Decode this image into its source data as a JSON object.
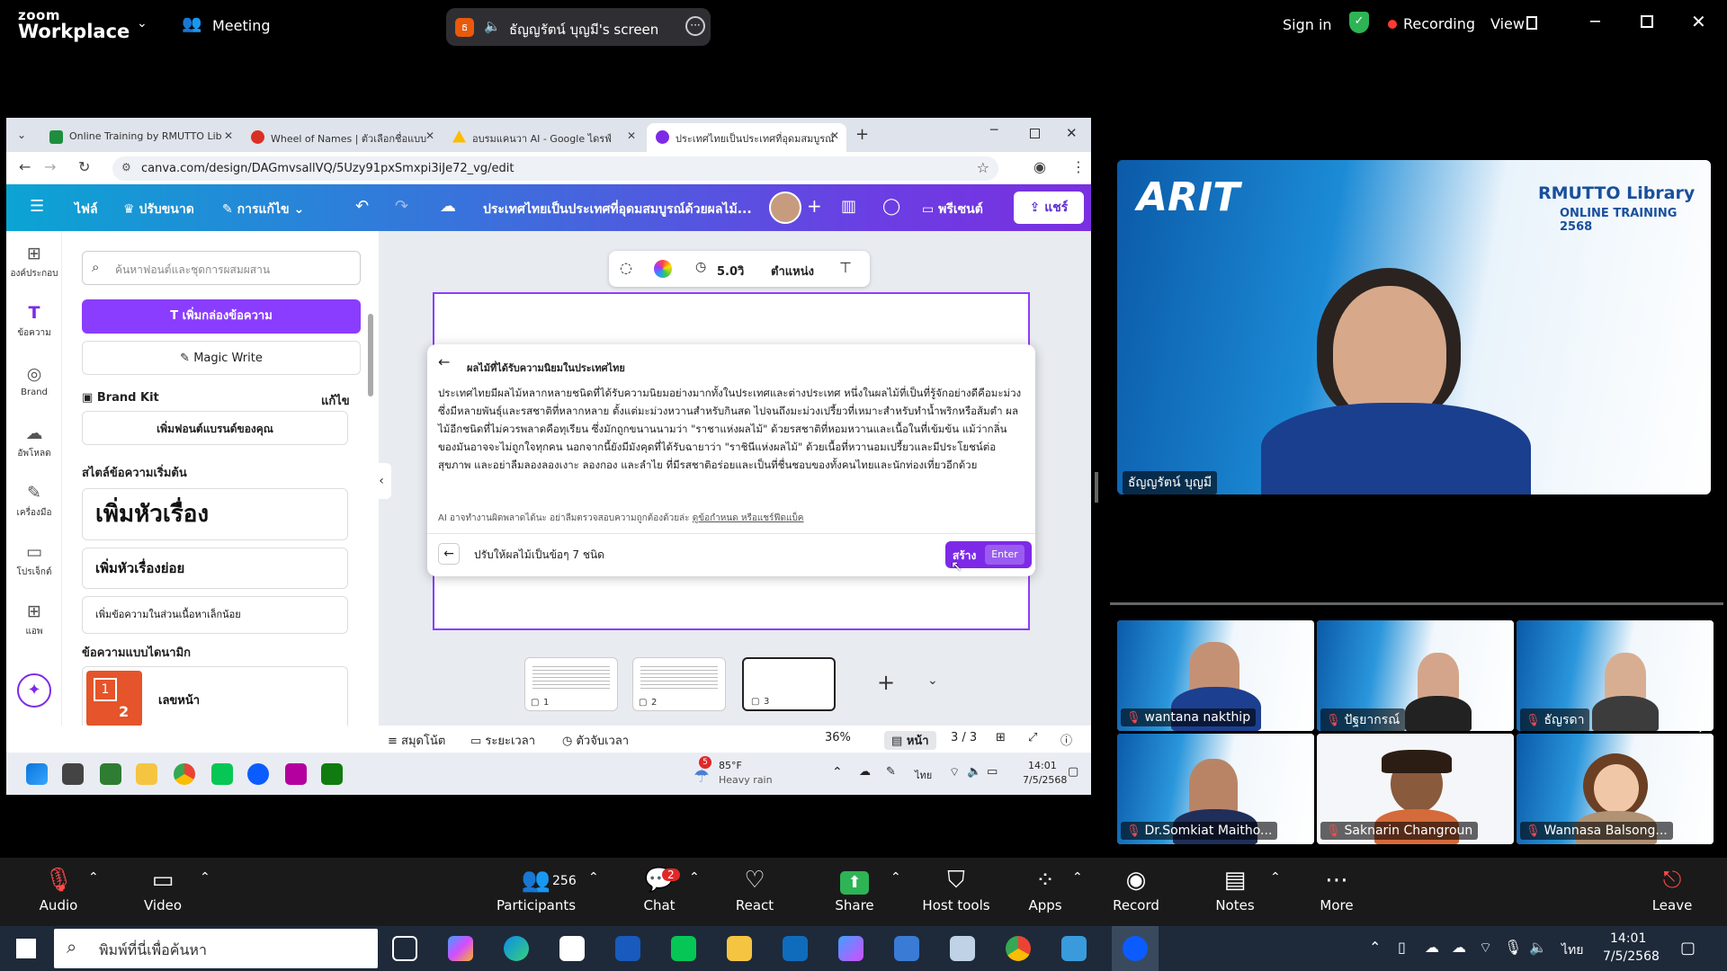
{
  "zoom": {
    "logo_line1": "zoom",
    "logo_line2": "Workplace",
    "meeting_label": "Meeting",
    "share_badge": "ธ",
    "share_label": "ธัญญรัตน์ บุญมี's screen",
    "sign_in": "Sign in",
    "recording": "Recording",
    "view": "View"
  },
  "browser": {
    "tabs": [
      {
        "label": "Online Training by RMUTTO Lib",
        "color": "#1e8e3e"
      },
      {
        "label": "Wheel of Names | ตัวเลือกชื่อแบบ",
        "color": "#d93025"
      },
      {
        "label": "อบรมแคนวา AI - Google ไดรฟ์",
        "color": "#fbbc04"
      },
      {
        "label": "ประเทศไทยเป็นประเทศที่อุดมสมบูรณ์",
        "color": "#7d2ae8"
      }
    ],
    "url": "canva.com/design/DAGmvsallVQ/5Uzy91pxSmxpi3iJe72_vg/edit"
  },
  "canva": {
    "menu": {
      "file": "ไฟล์",
      "resize": "ปรับขนาด",
      "edit": "การแก้ไข",
      "title": "ประเทศไทยเป็นประเทศที่อุดมสมบูรณ์ด้วยผลไม้...",
      "present": "พรีเซนต์",
      "share": "แชร์"
    },
    "rail": [
      {
        "icon": "⊞",
        "label": "องค์ประกอบ"
      },
      {
        "icon": "T",
        "label": "ข้อความ"
      },
      {
        "icon": "◎",
        "label": "Brand"
      },
      {
        "icon": "☁",
        "label": "อัพโหลด"
      },
      {
        "icon": "✎",
        "label": "เครื่องมือ"
      },
      {
        "icon": "▭",
        "label": "โปรเจ็กต์"
      },
      {
        "icon": "⊞",
        "label": "แอพ"
      }
    ],
    "panel": {
      "search_placeholder": "ค้นหาฟอนต์และชุดการผสมผสาน",
      "add_text_box": "เพิ่มกล่องข้อความ",
      "magic_write": "Magic Write",
      "brand_kit": "Brand Kit",
      "brand_edit": "แก้ไข",
      "add_brand_font": "เพิ่มฟอนต์แบรนด์ของคุณ",
      "default_styles": "สไตล์ข้อความเริ่มต้น",
      "heading": "เพิ่มหัวเรื่อง",
      "subheading": "เพิ่มหัวเรื่องย่อย",
      "body": "เพิ่มข้อความในส่วนเนื้อหาเล็กน้อย",
      "dynamic_text": "ข้อความแบบไดนามิก",
      "page_number": "เลขหน้า",
      "page_num_badge_1": "1",
      "page_num_badge_2": "2"
    },
    "toolbar": {
      "duration": "5.0วิ",
      "position": "ตำแหน่ง"
    },
    "ai": {
      "title": "ผลไม้ที่ได้รับความนิยมในประเทศไทย",
      "body": "ประเทศไทยมีผลไม้หลากหลายชนิดที่ได้รับความนิยมอย่างมากทั้งในประเทศและต่างประเทศ หนึ่งในผลไม้ที่เป็นที่รู้จักอย่างดีคือมะม่วง ซึ่งมีหลายพันธุ์และรสชาติที่หลากหลาย ตั้งแต่มะม่วงหวานสำหรับกินสด ไปจนถึงมะม่วงเปรี้ยวที่เหมาะสำหรับทำน้ำพริกหรือส้มตำ ผลไม้อีกชนิดที่ไม่ควรพลาดคือทุเรียน ซึ่งมักถูกขนานนามว่า \"ราชาแห่งผลไม้\" ด้วยรสชาติที่หอมหวานและเนื้อในที่เข้มข้น แม้ว่ากลิ่นของมันอาจจะไม่ถูกใจทุกคน นอกจากนี้ยังมีมังคุดที่ได้รับฉายาว่า \"ราชินีแห่งผลไม้\" ด้วยเนื้อที่หวานอมเปรี้ยวและมีประโยชน์ต่อสุขภาพ และอย่าลืมลองลองเงาะ ลองกอง และลำไย ที่มีรสชาติอร่อยและเป็นที่ชื่นชอบของทั้งคนไทยและนักท่องเที่ยวอีกด้วย",
      "disclaimer": "AI อาจทำงานผิดพลาดได้นะ อย่าลืมตรวจสอบความถูกต้องด้วยล่ะ",
      "disclaimer_link": "ดูข้อกำหนด หรือแชร์ฟีดแบ็ค",
      "prompt": "ปรับให้ผลไม้เป็นข้อๆ 7 ชนิด",
      "generate": "สร้าง",
      "enter": "Enter"
    },
    "thumbs": [
      {
        "num": "1"
      },
      {
        "num": "2"
      },
      {
        "num": "3"
      }
    ],
    "footer": {
      "notes": "สมุดโน้ต",
      "timeline": "ระยะเวลา",
      "timer": "ตัวจับเวลา",
      "zoom": "36%",
      "page_view": "หน้า",
      "pages": "3 / 3"
    }
  },
  "inner_taskbar": {
    "weather_badge": "5",
    "weather_temp": "85°F",
    "weather_desc": "Heavy rain",
    "lang": "ไทย",
    "time": "14:01",
    "date": "7/5/2568"
  },
  "videos": {
    "speaker": {
      "name": "ธัญญรัตน์ บุญมี",
      "logo": "ARIT",
      "banner1": "RMUTTO Library",
      "banner2": "ONLINE TRAINING 2568"
    },
    "gallery": [
      {
        "name": "wantana nakthip"
      },
      {
        "name": "ปัฐยากรณ์"
      },
      {
        "name": "ธัญรดา"
      },
      {
        "name": "Dr.Somkiat Maitho..."
      },
      {
        "name": "Saknarin Changroun"
      },
      {
        "name": "Wannasa Balsong..."
      }
    ]
  },
  "toolbar": {
    "audio": "Audio",
    "video": "Video",
    "participants": "Participants",
    "participants_count": "256",
    "chat": "Chat",
    "chat_badge": "2",
    "react": "React",
    "share": "Share",
    "host_tools": "Host tools",
    "apps": "Apps",
    "record": "Record",
    "notes": "Notes",
    "more": "More",
    "leave": "Leave"
  },
  "windows": {
    "search_placeholder": "พิมพ์ที่นี่เพื่อค้นหา",
    "lang": "ไทย",
    "time": "14:01",
    "date": "7/5/2568"
  }
}
